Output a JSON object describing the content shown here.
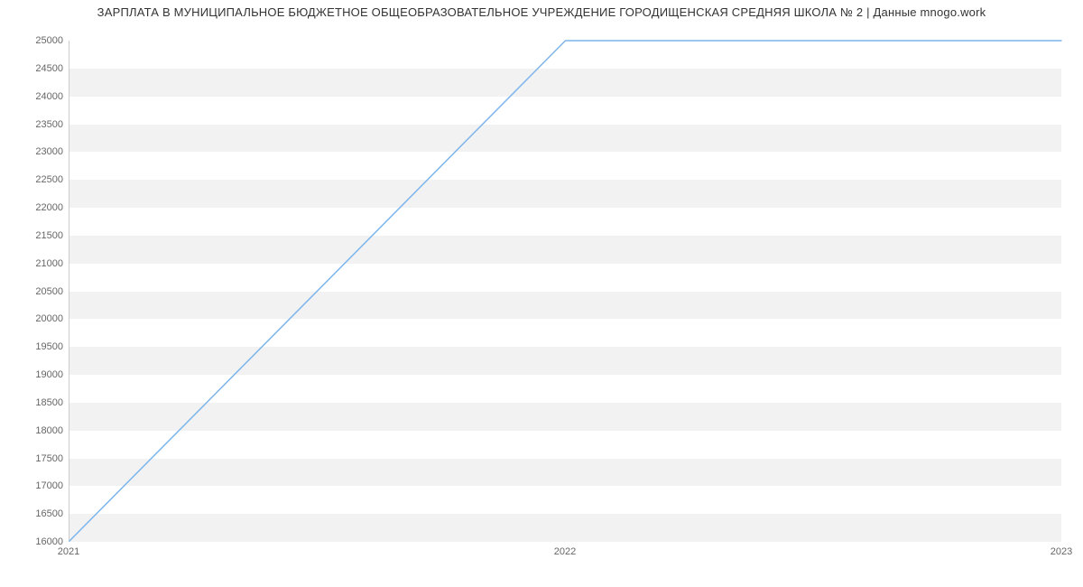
{
  "chart_data": {
    "type": "line",
    "title": "ЗАРПЛАТА В МУНИЦИПАЛЬНОЕ БЮДЖЕТНОЕ ОБЩЕОБРАЗОВАТЕЛЬНОЕ УЧРЕЖДЕНИЕ ГОРОДИЩЕНСКАЯ СРЕДНЯЯ ШКОЛА № 2 | Данные mnogo.work",
    "x": [
      2021,
      2022,
      2023
    ],
    "values": [
      16000,
      25000,
      25000
    ],
    "xlabel": "",
    "ylabel": "",
    "xlim": [
      2021,
      2023
    ],
    "ylim": [
      16000,
      25000
    ],
    "x_ticks": [
      2021,
      2022,
      2023
    ],
    "y_ticks": [
      16000,
      16500,
      17000,
      17500,
      18000,
      18500,
      19000,
      19500,
      20000,
      20500,
      21000,
      21500,
      22000,
      22500,
      23000,
      23500,
      24000,
      24500,
      25000
    ],
    "line_color": "#7cb5ec",
    "grid": true
  }
}
